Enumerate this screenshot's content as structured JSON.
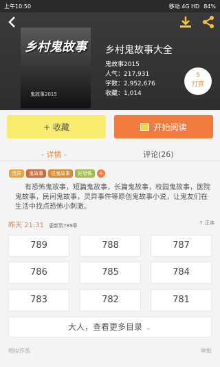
{
  "status": {
    "time": "上午10:50",
    "carrier": "移动 4G HD",
    "battery": "84%"
  },
  "book": {
    "cover_title": "乡村鬼故事",
    "cover_author": "鬼故事2015",
    "title": "乡村鬼故事大全",
    "author": "鬼故事2015",
    "popularity": "人气：217,931",
    "word_count": "字数：2,952,676",
    "collects": "收藏：1,014"
  },
  "reward": {
    "count": "5",
    "label": "打赏"
  },
  "actions": {
    "favorite": "+ 收藏",
    "read": "开始阅读"
  },
  "tabs": {
    "detail": "- 详情 -",
    "comments": "评论(26)"
  },
  "tags": [
    {
      "label": "灵异",
      "color": "#f0a33c"
    },
    {
      "label": "鬼故事",
      "color": "#c86f3e"
    },
    {
      "label": "说鬼故事",
      "color": "#d88b33"
    },
    {
      "label": "好恐怖",
      "color": "#9fbf4a"
    }
  ],
  "description": "有恐怖鬼故事，短篇鬼故事，长篇鬼故事，校园鬼故事，医院鬼故事，民间鬼故事，灵异事件等原创鬼故事小说，让鬼友们在生活中找点恐怖小刺激。",
  "update": {
    "time": "昨天 21:31",
    "chapter": "更新到789章",
    "order": "正序"
  },
  "chapters": [
    "789",
    "788",
    "787",
    "786",
    "785",
    "784",
    "783",
    "782",
    "781"
  ],
  "more_label": "大人，查看更多目录",
  "bottom": {
    "similar": "相似作品",
    "report": "举报"
  }
}
